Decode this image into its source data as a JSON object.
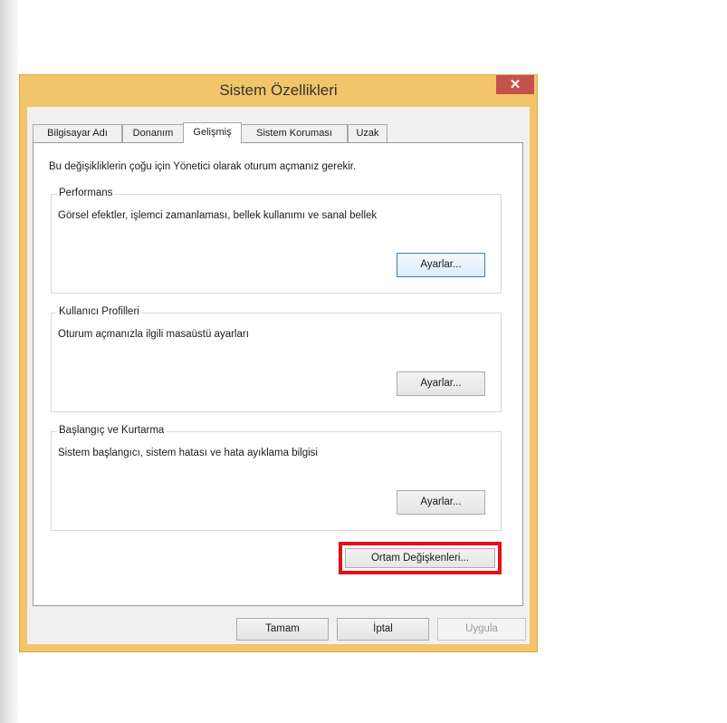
{
  "window": {
    "title": "Sistem Özellikleri",
    "close_label": "✕"
  },
  "tabs": [
    {
      "label": "Bilgisayar Adı",
      "active": false
    },
    {
      "label": "Donanım",
      "active": false
    },
    {
      "label": "Gelişmiş",
      "active": true
    },
    {
      "label": "Sistem Koruması",
      "active": false
    },
    {
      "label": "Uzak",
      "active": false
    }
  ],
  "advanced": {
    "note": "Bu değişikliklerin çoğu için Yönetici olarak oturum açmanız gerekir.",
    "groups": [
      {
        "title": "Performans",
        "description": "Görsel efektler, işlemci zamanlaması, bellek kullanımı ve sanal bellek",
        "button_label": "Ayarlar..."
      },
      {
        "title": "Kullanıcı Profilleri",
        "description": "Oturum açmanızla ilgili masaüstü ayarları",
        "button_label": "Ayarlar..."
      },
      {
        "title": "Başlangıç ve Kurtarma",
        "description": "Sistem başlangıcı, sistem hatası ve hata ayıklama bilgisi",
        "button_label": "Ayarlar..."
      }
    ],
    "env_button_label": "Ortam Değişkenleri..."
  },
  "footer": {
    "ok_label": "Tamam",
    "cancel_label": "İptal",
    "apply_label": "Uygula"
  },
  "colors": {
    "title_bar": "#f2c56a",
    "close_button": "#c7504b",
    "highlight_border": "#e3101c"
  }
}
